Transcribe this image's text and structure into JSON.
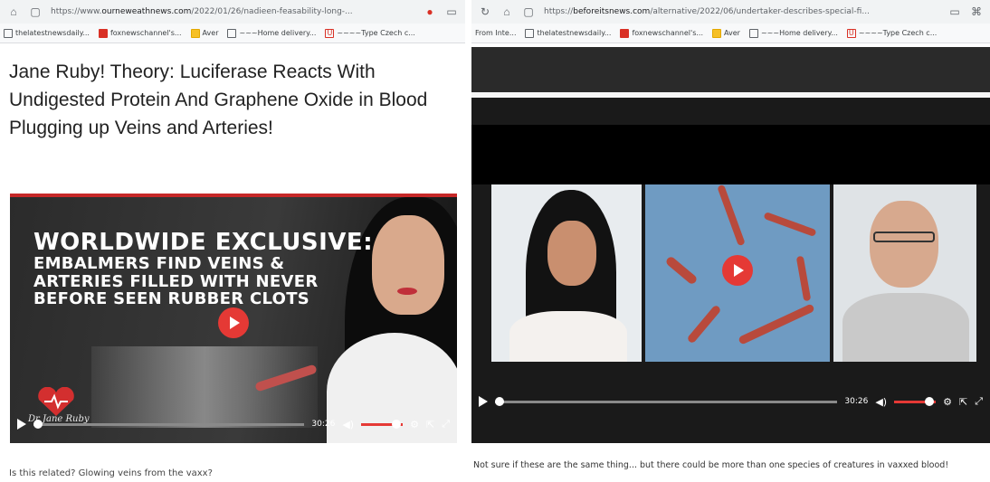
{
  "left": {
    "address_bar": {
      "url_prefix": "https://www.",
      "url_domain": "ourneweathnews.com",
      "url_path": "/2022/01/26/nadieen-feasability-long-..."
    },
    "bookmarks": [
      "thelatestnewsdaily...",
      "foxnewschannel's...",
      "Aver",
      "~~~Home delivery...",
      "~~~~Type Czech c..."
    ],
    "headline": "Jane Ruby! Theory: Luciferase Reacts With Undigested Protein And Graphene Oxide in Blood Plugging up Veins and Arteries!",
    "video": {
      "title_line1": "WORLDWIDE EXCLUSIVE:",
      "title_line2": "EMBALMERS FIND VEINS &",
      "title_line3": "ARTERIES FILLED WITH NEVER",
      "title_line4": "BEFORE SEEN RUBBER CLOTS",
      "logo_text": "Dr Jane Ruby",
      "duration": "30:26",
      "progress": 0.0,
      "volume": 0.85
    },
    "caption": "Is this related? Glowing veins from the vaxx?"
  },
  "right": {
    "address_bar": {
      "url_prefix": "https://",
      "url_domain": "beforeitsnews.com",
      "url_path": "/alternative/2022/06/undertaker-describes-special-fi..."
    },
    "bookmarks": [
      "From Inte...",
      "thelatestnewsdaily...",
      "foxnewschannel's...",
      "Aver",
      "~~~Home delivery...",
      "~~~~Type Czech c..."
    ],
    "video": {
      "duration": "30:26",
      "progress": 0.0,
      "volume": 0.85
    },
    "caption": "Not sure if these are the same thing... but there could be more than one species of creatures in vaxxed blood!"
  },
  "colors": {
    "accent_red": "#e53935",
    "banner_red": "#c62828",
    "chrome_bar": "#f1f3f4"
  }
}
